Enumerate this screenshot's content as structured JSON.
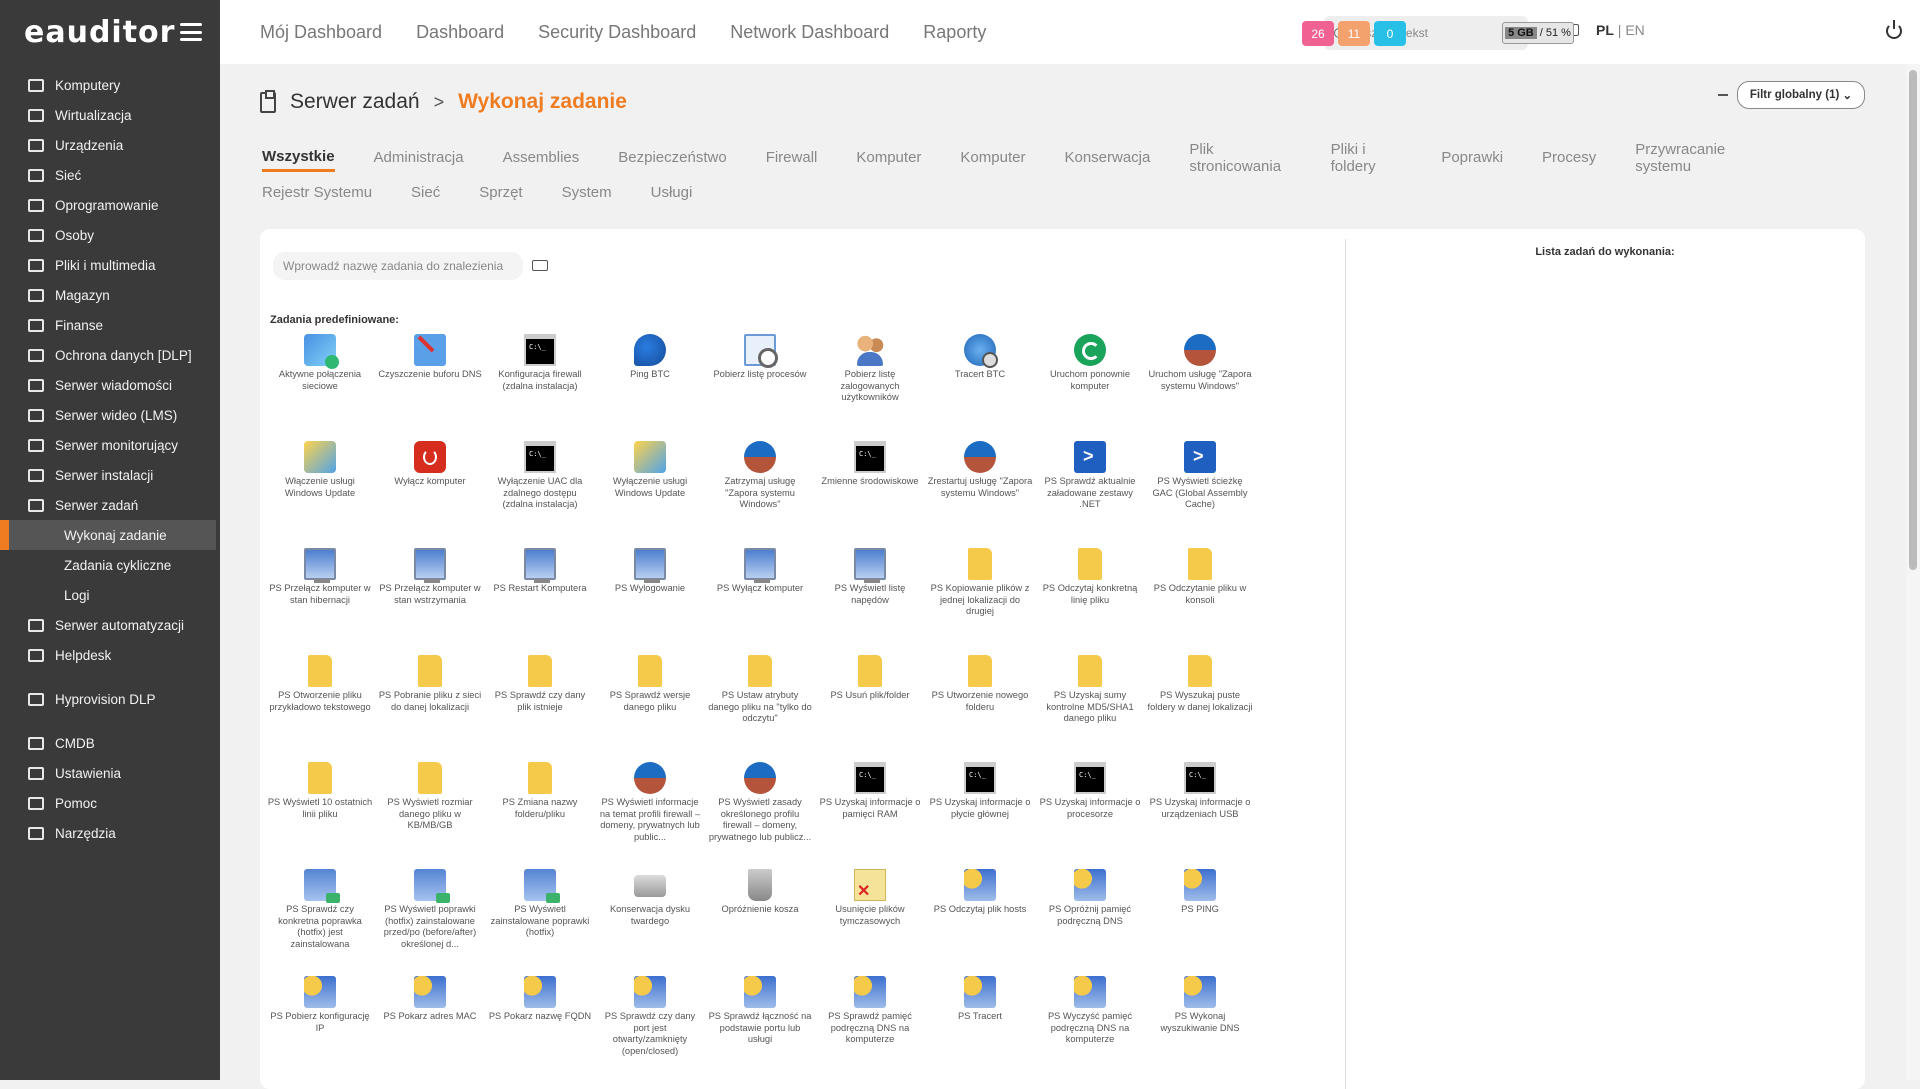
{
  "app": {
    "logo": "eauditor"
  },
  "sidebar": {
    "items": [
      {
        "label": "Komputery",
        "icon": "monitor-icon"
      },
      {
        "label": "Wirtualizacja",
        "icon": "server-stack-icon"
      },
      {
        "label": "Urządzenia",
        "icon": "devices-icon"
      },
      {
        "label": "Sieć",
        "icon": "network-icon"
      },
      {
        "label": "Oprogramowanie",
        "icon": "software-icon"
      },
      {
        "label": "Osoby",
        "icon": "people-icon"
      },
      {
        "label": "Pliki i multimedia",
        "icon": "files-icon"
      },
      {
        "label": "Magazyn",
        "icon": "warehouse-icon"
      },
      {
        "label": "Finanse",
        "icon": "finance-icon"
      },
      {
        "label": "Ochrona danych [DLP]",
        "icon": "shield-icon"
      },
      {
        "label": "Serwer wiadomości",
        "icon": "mail-icon"
      },
      {
        "label": "Serwer wideo (LMS)",
        "icon": "video-icon"
      },
      {
        "label": "Serwer monitorujący",
        "icon": "monitoring-icon"
      },
      {
        "label": "Serwer instalacji",
        "icon": "install-icon"
      },
      {
        "label": "Serwer zadań",
        "icon": "clipboard-icon"
      }
    ],
    "subitems": [
      {
        "label": "Wykonaj zadanie",
        "active": true
      },
      {
        "label": "Zadania cykliczne",
        "active": false
      },
      {
        "label": "Logi",
        "active": false
      }
    ],
    "items_after": [
      {
        "label": "Serwer automatyzacji",
        "icon": "automation-icon"
      },
      {
        "label": "Helpdesk",
        "icon": "helpdesk-icon"
      }
    ],
    "group2": [
      {
        "label": "Hyprovision DLP",
        "icon": "hyprovision-icon"
      }
    ],
    "group3": [
      {
        "label": "CMDB",
        "icon": "database-icon"
      },
      {
        "label": "Ustawienia",
        "icon": "gear-icon"
      },
      {
        "label": "Pomoc",
        "icon": "help-icon"
      },
      {
        "label": "Narzędzia",
        "icon": "tools-icon"
      }
    ]
  },
  "topbar": {
    "tabs": [
      "Mój Dashboard",
      "Dashboard",
      "Security Dashboard",
      "Network Dashboard",
      "Raporty"
    ],
    "search_placeholder": "Wyszukaj tekst",
    "badges": [
      {
        "value": "26",
        "color": "#f06292"
      },
      {
        "value": "11",
        "color": "#f4a26d"
      },
      {
        "value": "0",
        "color": "#29c0e8"
      }
    ],
    "memory": {
      "size": "5 GB",
      "percent": "/ 51 %"
    },
    "lang_active": "PL",
    "lang_sep": " | ",
    "lang_other": "EN"
  },
  "page": {
    "crumb_parent": "Serwer zadań",
    "crumb_sep": ">",
    "crumb_current": "Wykonaj zadanie",
    "filter_label": "Filtr globalny (1)"
  },
  "categories": {
    "row1": [
      "Wszystkie",
      "Administracja",
      "Assemblies",
      "Bezpieczeństwo",
      "Firewall",
      "Komputer",
      "Komputer",
      "Konserwacja",
      "Plik stronicowania",
      "Pliki i foldery",
      "Poprawki",
      "Procesy",
      "Przywracanie systemu"
    ],
    "row2": [
      "Rejestr Systemu",
      "Sieć",
      "Sprzęt",
      "System",
      "Usługi"
    ],
    "active": "Wszystkie"
  },
  "tasks_panel": {
    "search_placeholder": "Wprowadź nazwę zadania do znalezienia",
    "section_title": "Zadania predefiniowane:",
    "list_title": "Lista zadań do wykonania:",
    "tasks": [
      {
        "label": "Aktywne połączenia sieciowe",
        "icon": "t-net"
      },
      {
        "label": "Czyszczenie buforu DNS",
        "icon": "t-dns"
      },
      {
        "label": "Konfiguracja firewall (zdalna instalacja)",
        "icon": "t-cmd"
      },
      {
        "label": "Ping BTC",
        "icon": "t-ping"
      },
      {
        "label": "Pobierz listę procesów",
        "icon": "t-proc"
      },
      {
        "label": "Pobierz listę zalogowanych użytkowników",
        "icon": "t-users"
      },
      {
        "label": "Tracert BTC",
        "icon": "t-tracert"
      },
      {
        "label": "Uruchom ponownie komputer",
        "icon": "t-restart"
      },
      {
        "label": "Uruchom usługę \"Zapora systemu Windows\"",
        "icon": "t-fw"
      },
      {
        "label": "Włączenie usługi Windows Update",
        "icon": "t-wu"
      },
      {
        "label": "Wyłącz komputer",
        "icon": "t-power"
      },
      {
        "label": "Wyłączenie UAC dla zdalnego dostępu (zdalna instalacja)",
        "icon": "t-cmd"
      },
      {
        "label": "Wyłączenie usługi Windows Update",
        "icon": "t-wu"
      },
      {
        "label": "Zatrzymaj usługę \"Zapora systemu Windows\"",
        "icon": "t-fw"
      },
      {
        "label": "Zmienne środowiskowe",
        "icon": "t-cmd"
      },
      {
        "label": "Zrestartuj usługę \"Zapora systemu Windows\"",
        "icon": "t-fw"
      },
      {
        "label": "PS Sprawdź aktualnie załadowane zestawy .NET",
        "icon": "t-ps"
      },
      {
        "label": "PS Wyświetl ścieżkę GAC (Global Assembly Cache)",
        "icon": "t-ps"
      },
      {
        "label": "PS Przełącz komputer w stan hibernacji",
        "icon": "t-pc"
      },
      {
        "label": "PS Przełącz komputer w stan wstrzymania",
        "icon": "t-pc"
      },
      {
        "label": "PS Restart Komputera",
        "icon": "t-pc"
      },
      {
        "label": "PS Wylogowanie",
        "icon": "t-pc"
      },
      {
        "label": "PS Wyłącz komputer",
        "icon": "t-pc"
      },
      {
        "label": "PS Wyświetl listę napędów",
        "icon": "t-pc"
      },
      {
        "label": "PS Kopiowanie plików z jednej lokalizacji do drugiej",
        "icon": "t-folder"
      },
      {
        "label": "PS Odczytaj konkretną linię pliku",
        "icon": "t-folder"
      },
      {
        "label": "PS Odczytanie pliku w konsoli",
        "icon": "t-folder"
      },
      {
        "label": "PS Otworzenie pliku przykładowo tekstowego",
        "icon": "t-folder"
      },
      {
        "label": "PS Pobranie pliku z sieci do danej lokalizacji",
        "icon": "t-folder"
      },
      {
        "label": "PS Sprawdź czy dany plik istnieje",
        "icon": "t-folder"
      },
      {
        "label": "PS Sprawdź wersje danego pliku",
        "icon": "t-folder"
      },
      {
        "label": "PS Ustaw atrybuty danego pliku na \"tylko do odczytu\"",
        "icon": "t-folder"
      },
      {
        "label": "PS Usuń plik/folder",
        "icon": "t-folder"
      },
      {
        "label": "PS Utworzenie nowego folderu",
        "icon": "t-folder"
      },
      {
        "label": "PS Uzyskaj sumy kontrolne MD5/SHA1 danego pliku",
        "icon": "t-folder"
      },
      {
        "label": "PS Wyszukaj puste foldery w danej lokalizacji",
        "icon": "t-folder"
      },
      {
        "label": "PS Wyświetl 10 ostatnich linii pliku",
        "icon": "t-folder"
      },
      {
        "label": "PS Wyświetl rozmiar danego pliku w KB/MB/GB",
        "icon": "t-folder"
      },
      {
        "label": "PS Zmiana nazwy folderu/pliku",
        "icon": "t-folder"
      },
      {
        "label": "PS Wyświetl informacje na temat profili firewall – domeny, prywatnych lub public...",
        "icon": "t-fw"
      },
      {
        "label": "PS Wyświetl zasady określonego profilu firewall – domeny, prywatnego lub publicz...",
        "icon": "t-fw"
      },
      {
        "label": "PS Uzyskaj informacje o pamięci RAM",
        "icon": "t-cmd"
      },
      {
        "label": "PS Uzyskaj informacje o płycie głównej",
        "icon": "t-cmd"
      },
      {
        "label": "PS Uzyskaj informacje o procesorze",
        "icon": "t-cmd"
      },
      {
        "label": "PS Uzyskaj informacje o urządzeniach USB",
        "icon": "t-cmd"
      },
      {
        "label": "PS Sprawdź czy konkretna poprawka (hotfix) jest zainstalowana",
        "icon": "t-net2"
      },
      {
        "label": "PS Wyświetl poprawki (hotfix) zainstalowane przed/po (before/after) określonej d...",
        "icon": "t-net2"
      },
      {
        "label": "PS Wyświetl zainstalowane poprawki (hotfix)",
        "icon": "t-net2"
      },
      {
        "label": "Konserwacja dysku twardego",
        "icon": "t-disk"
      },
      {
        "label": "Opróżnienie kosza",
        "icon": "t-trash"
      },
      {
        "label": "Usunięcie plików tymczasowych",
        "icon": "t-tempdel"
      },
      {
        "label": "PS Odczytaj plik hosts",
        "icon": "t-netpc"
      },
      {
        "label": "PS Opróżnij pamięć podręczną DNS",
        "icon": "t-netpc"
      },
      {
        "label": "PS PING",
        "icon": "t-netpc"
      },
      {
        "label": "PS Pobierz konfigurację IP",
        "icon": "t-netpc"
      },
      {
        "label": "PS Pokarz adres MAC",
        "icon": "t-netpc"
      },
      {
        "label": "PS Pokarz nazwę FQDN",
        "icon": "t-netpc"
      },
      {
        "label": "PS Sprawdź czy dany port jest otwarty/zamknięty (open/closed)",
        "icon": "t-netpc"
      },
      {
        "label": "PS Sprawdź łączność na podstawie portu lub usługi",
        "icon": "t-netpc"
      },
      {
        "label": "PS Sprawdź pamięć podręczną DNS na komputerze",
        "icon": "t-netpc"
      },
      {
        "label": "PS Tracert",
        "icon": "t-netpc"
      },
      {
        "label": "PS Wyczyść pamięć podręczną DNS na komputerze",
        "icon": "t-netpc"
      },
      {
        "label": "PS Wykonaj wyszukiwanie DNS",
        "icon": "t-netpc"
      }
    ]
  },
  "colors": {
    "accent": "#f07c22",
    "sidebar_bg": "#3a3a3a"
  }
}
